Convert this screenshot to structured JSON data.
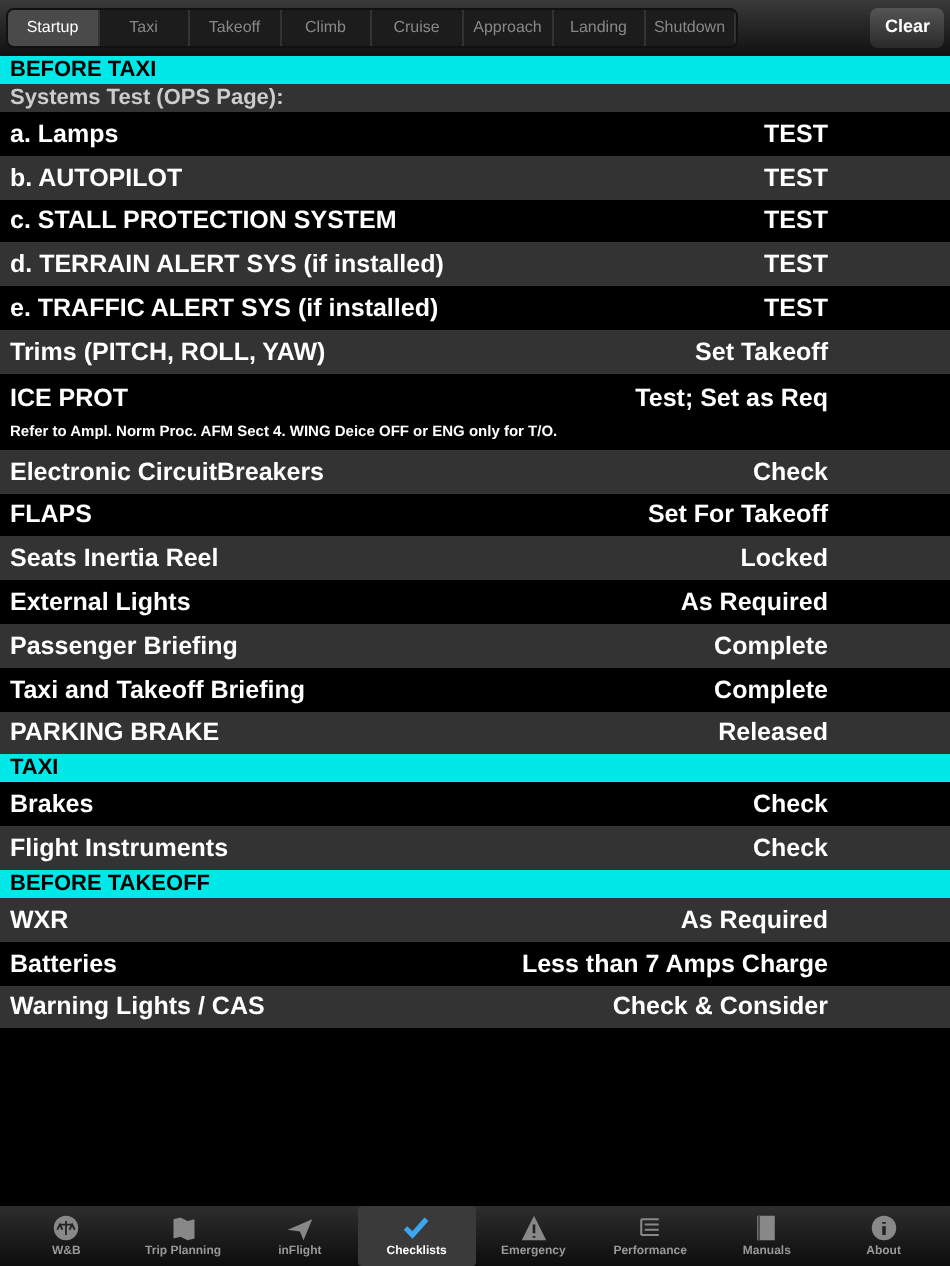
{
  "segments": [
    {
      "label": "Startup",
      "selected": true
    },
    {
      "label": "Taxi",
      "selected": false
    },
    {
      "label": "Takeoff",
      "selected": false
    },
    {
      "label": "Climb",
      "selected": false
    },
    {
      "label": "Cruise",
      "selected": false
    },
    {
      "label": "Approach",
      "selected": false
    },
    {
      "label": "Landing",
      "selected": false
    },
    {
      "label": "Shutdown",
      "selected": false
    }
  ],
  "clear_button": "Clear",
  "sections": [
    {
      "title": "BEFORE TAXI",
      "rows": [
        {
          "label": "Systems Test (OPS Page):",
          "kind": "cut"
        },
        {
          "label": "a. Lamps",
          "value": "TEST"
        },
        {
          "label": "b. AUTOPILOT",
          "value": "TEST"
        },
        {
          "label": "c. STALL PROTECTION SYSTEM",
          "value": "TEST"
        },
        {
          "label": "d. TERRAIN ALERT SYS (if installed)",
          "value": "TEST"
        },
        {
          "label": "e. TRAFFIC ALERT SYS (if installed)",
          "value": "TEST"
        },
        {
          "label": "Trims (PITCH, ROLL, YAW)",
          "value": "Set Takeoff"
        },
        {
          "label": "ICE PROT",
          "value": "Test; Set as Req",
          "note": "Refer to Ampl. Norm Proc. AFM Sect 4. WING Deice OFF or ENG only for T/O."
        },
        {
          "label": "Electronic CircuitBreakers",
          "value": "Check"
        },
        {
          "label": "FLAPS",
          "value": "Set For Takeoff"
        },
        {
          "label": "Seats Inertia Reel",
          "value": "Locked"
        },
        {
          "label": "External Lights",
          "value": "As Required"
        },
        {
          "label": "Passenger Briefing",
          "value": "Complete"
        },
        {
          "label": "Taxi and Takeoff Briefing",
          "value": "Complete"
        },
        {
          "label": "PARKING BRAKE",
          "value": "Released"
        }
      ]
    },
    {
      "title": "TAXI",
      "rows": [
        {
          "label": "Brakes",
          "value": "Check"
        },
        {
          "label": "Flight Instruments",
          "value": "Check"
        }
      ]
    },
    {
      "title": "BEFORE TAKEOFF",
      "rows": [
        {
          "label": "WXR",
          "value": "As Required"
        },
        {
          "label": "Batteries",
          "value": "Less than 7 Amps Charge"
        },
        {
          "label": "Warning Lights / CAS",
          "value": "Check & Consider"
        }
      ]
    }
  ],
  "tab_bar": [
    {
      "label": "W&B",
      "kind": "scale",
      "selected": false
    },
    {
      "label": "Trip Planning",
      "kind": "map",
      "selected": false
    },
    {
      "label": "inFlight",
      "kind": "plane",
      "selected": false
    },
    {
      "label": "Checklists",
      "kind": "check",
      "selected": true
    },
    {
      "label": "Emergency",
      "kind": "warning",
      "selected": false
    },
    {
      "label": "Performance",
      "kind": "list",
      "selected": false
    },
    {
      "label": "Manuals",
      "kind": "book",
      "selected": false
    },
    {
      "label": "About",
      "kind": "info",
      "selected": false
    }
  ]
}
